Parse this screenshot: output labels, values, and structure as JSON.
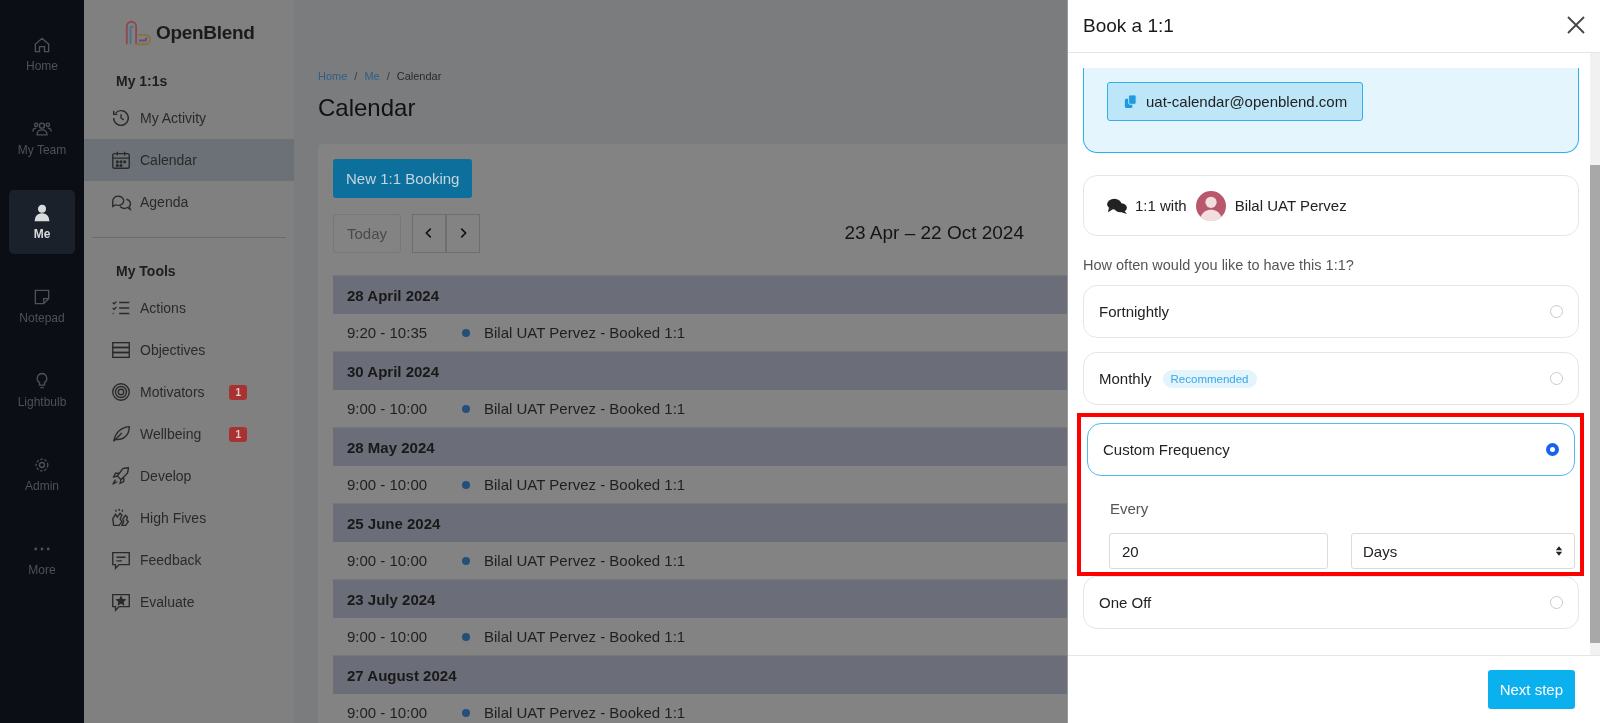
{
  "rail": {
    "items": [
      {
        "label": "Home",
        "selected": false
      },
      {
        "label": "My Team",
        "selected": false
      },
      {
        "label": "Me",
        "selected": true
      },
      {
        "label": "Notepad",
        "selected": false
      },
      {
        "label": "Lightbulb",
        "selected": false
      },
      {
        "label": "Admin",
        "selected": false
      },
      {
        "label": "More",
        "selected": false
      }
    ]
  },
  "sidebar": {
    "logo": "OpenBlend",
    "sections": [
      {
        "title": "My 1:1s",
        "items": [
          {
            "label": "My Activity",
            "selected": false
          },
          {
            "label": "Calendar",
            "selected": true
          },
          {
            "label": "Agenda",
            "selected": false
          }
        ]
      },
      {
        "title": "My Tools",
        "items": [
          {
            "label": "Actions",
            "selected": false
          },
          {
            "label": "Objectives",
            "selected": false
          },
          {
            "label": "Motivators",
            "selected": false,
            "badge": "1"
          },
          {
            "label": "Wellbeing",
            "selected": false,
            "badge": "1"
          },
          {
            "label": "Develop",
            "selected": false
          },
          {
            "label": "High Fives",
            "selected": false
          },
          {
            "label": "Feedback",
            "selected": false
          },
          {
            "label": "Evaluate",
            "selected": false
          }
        ]
      }
    ]
  },
  "breadcrumb": {
    "items": [
      "Home",
      "Me",
      "Calendar"
    ],
    "separators": [
      "/",
      "/"
    ]
  },
  "page_title": "Calendar",
  "new_booking_button": "New 1:1 Booking",
  "today_button": "Today",
  "date_range": "23 Apr – 22 Oct 2024",
  "agenda": [
    {
      "date": "28 April 2024",
      "events": [
        {
          "time": "9:20 - 10:35",
          "title": "Bilal UAT Pervez - Booked 1:1"
        }
      ]
    },
    {
      "date": "30 April 2024",
      "events": [
        {
          "time": "9:00 - 10:00",
          "title": "Bilal UAT Pervez - Booked 1:1"
        }
      ]
    },
    {
      "date": "28 May 2024",
      "events": [
        {
          "time": "9:00 - 10:00",
          "title": "Bilal UAT Pervez - Booked 1:1"
        }
      ]
    },
    {
      "date": "25 June 2024",
      "events": [
        {
          "time": "9:00 - 10:00",
          "title": "Bilal UAT Pervez - Booked 1:1"
        }
      ]
    },
    {
      "date": "23 July 2024",
      "events": [
        {
          "time": "9:00 - 10:00",
          "title": "Bilal UAT Pervez - Booked 1:1"
        }
      ]
    },
    {
      "date": "27 August 2024",
      "events": [
        {
          "time": "9:00 - 10:00",
          "title": "Bilal UAT Pervez - Booked 1:1"
        }
      ]
    }
  ],
  "drawer": {
    "title": "Book a 1:1",
    "email": "uat-calendar@openblend.com",
    "with_label": "1:1 with",
    "person": "Bilal UAT Pervez",
    "question": "How often would you like to have this 1:1?",
    "options": [
      {
        "label": "Fortnightly",
        "selected": false
      },
      {
        "label": "Monthly",
        "badge": "Recommended",
        "selected": false
      },
      {
        "label": "Custom Frequency",
        "selected": true,
        "kind": "custom",
        "every_label": "Every",
        "every_value": "20",
        "unit": "Days"
      },
      {
        "label": "One Off",
        "selected": false
      }
    ],
    "next_button": "Next step"
  }
}
